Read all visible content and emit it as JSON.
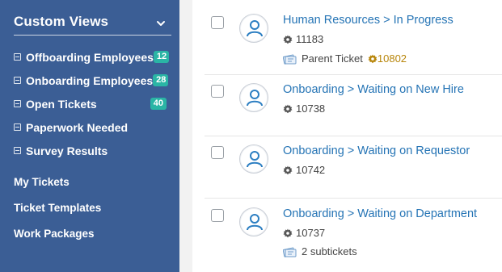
{
  "sidebar": {
    "title": "Custom Views",
    "views": [
      {
        "label": "Offboarding Employees",
        "count": "12"
      },
      {
        "label": "Onboarding Employees",
        "count": "28"
      },
      {
        "label": "Open Tickets",
        "count": "40"
      },
      {
        "label": "Paperwork Needed",
        "count": ""
      },
      {
        "label": "Survey Results",
        "count": ""
      }
    ],
    "links": [
      "My Tickets",
      "Ticket Templates",
      "Work Packages"
    ]
  },
  "tickets": [
    {
      "title": "Human Resources > In Progress",
      "number": "11183",
      "parent_label": "Parent Ticket",
      "parent_number": "10802"
    },
    {
      "title": "Onboarding > Waiting on New Hire",
      "number": "10738"
    },
    {
      "title": "Onboarding > Waiting on Requestor",
      "number": "10742"
    },
    {
      "title": "Onboarding > Waiting on Department",
      "number": "10737",
      "subtickets": "2 subtickets"
    }
  ],
  "colors": {
    "sidebar_bg": "#3b5e95",
    "badge": "#2ab5a5",
    "link": "#2574b5",
    "parent_number": "#b8860b"
  },
  "icons": [
    "chevron-down-icon",
    "list-icon",
    "user-avatar-icon",
    "gear-icon",
    "ticket-icon"
  ]
}
